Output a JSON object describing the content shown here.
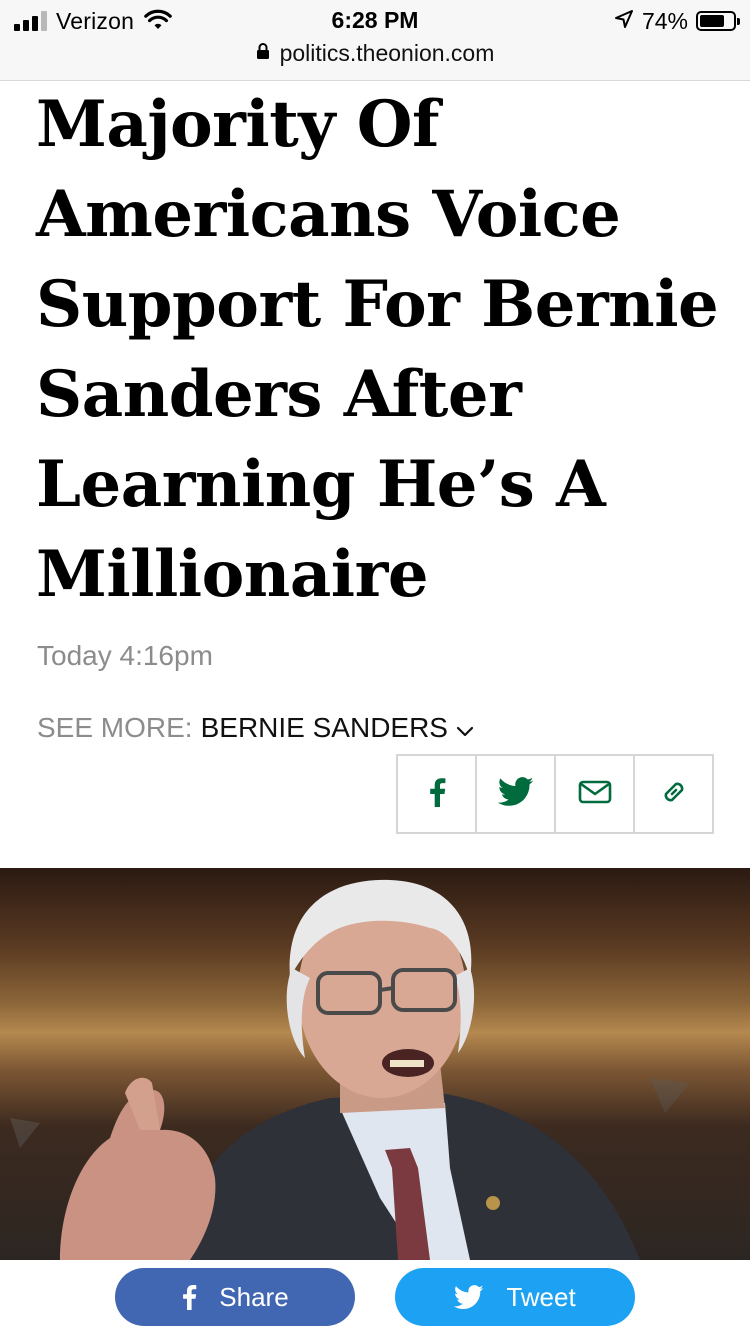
{
  "status_bar": {
    "carrier": "Verizon",
    "time": "6:28 PM",
    "battery_percent": "74%",
    "battery_level": 0.74,
    "signal_bars": 3,
    "url": "politics.theonion.com"
  },
  "article": {
    "headline": "Majority Of Americans Voice Support For Bernie Sanders After Learning He’s A Millionaire",
    "timestamp": "Today 4:16pm",
    "see_more_label": "SEE MORE:",
    "see_more_tag": "BERNIE SANDERS"
  },
  "share_icons": [
    "facebook-icon",
    "twitter-icon",
    "email-icon",
    "link-icon"
  ],
  "bottom_share": {
    "facebook_label": "Share",
    "twitter_label": "Tweet"
  },
  "colors": {
    "accent_green": "#006b3c",
    "facebook_blue": "#4267b2",
    "twitter_blue": "#1da1f2",
    "muted_text": "#8c8c8c"
  }
}
